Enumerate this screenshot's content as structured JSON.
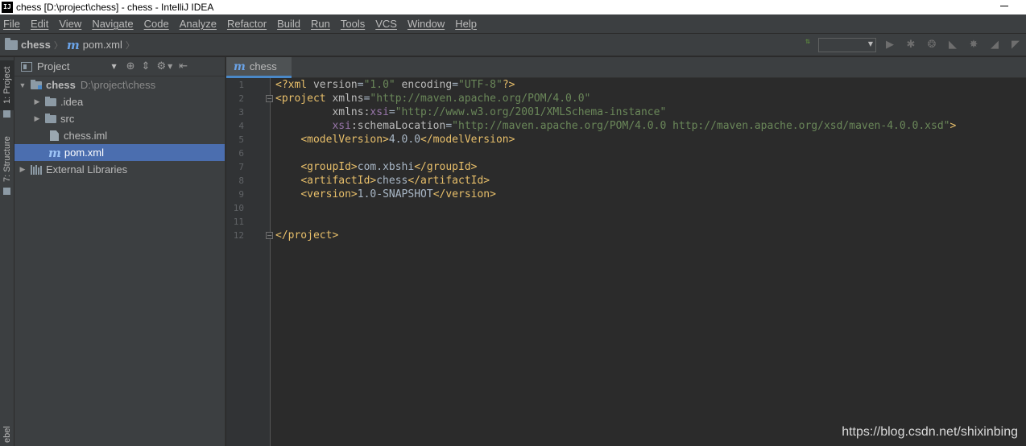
{
  "window": {
    "logo": "IJ",
    "title": "chess [D:\\project\\chess] - chess - IntelliJ IDEA"
  },
  "menu": [
    "File",
    "Edit",
    "View",
    "Navigate",
    "Code",
    "Analyze",
    "Refactor",
    "Build",
    "Run",
    "Tools",
    "VCS",
    "Window",
    "Help"
  ],
  "breadcrumb": {
    "project": "chess",
    "file": "pom.xml",
    "file_icon": "m"
  },
  "left_stripe": {
    "project_tab": "1: Project",
    "structure_tab": "7: Structure",
    "bottom_tab": "ebel"
  },
  "project_panel": {
    "title": "Project",
    "tree": [
      {
        "label": "chess",
        "path": "D:\\project\\chess"
      },
      {
        "label": ".idea"
      },
      {
        "label": "src"
      },
      {
        "label": "chess.iml"
      },
      {
        "label": "pom.xml"
      },
      {
        "label": "External Libraries"
      }
    ]
  },
  "editor": {
    "tab_label": "chess",
    "tab_icon": "m",
    "line_numbers": [
      "1",
      "2",
      "3",
      "4",
      "5",
      "6",
      "7",
      "8",
      "9",
      "10",
      "11",
      "12"
    ],
    "code": {
      "l1": {
        "open": "<?xml ",
        "a1": "version",
        "v1": "\"1.0\"",
        "a2": " encoding",
        "v2": "\"UTF-8\"",
        "close": "?>"
      },
      "l2": {
        "open": "<project ",
        "a1": "xmlns",
        "v1": "\"http://maven.apache.org/POM/4.0.0\""
      },
      "l3": {
        "indent": "         ",
        "a1": "xmlns",
        "colon": ":",
        "ns": "xsi",
        "v1": "\"http://www.w3.org/2001/XMLSchema-instance\""
      },
      "l4": {
        "indent": "         ",
        "ns": "xsi",
        "a1": ":schemaLocation",
        "v1": "\"http://maven.apache.org/POM/4.0.0 http://maven.apache.org/xsd/maven-4.0.0.xsd\"",
        "close": ">"
      },
      "l5": {
        "indent": "    ",
        "open": "<modelVersion>",
        "text": "4.0.0",
        "close": "</modelVersion>"
      },
      "l7": {
        "indent": "    ",
        "open": "<groupId>",
        "text": "com.xbshi",
        "close": "</groupId>"
      },
      "l8": {
        "indent": "    ",
        "open": "<artifactId>",
        "text": "chess",
        "close": "</artifactId>"
      },
      "l9": {
        "indent": "    ",
        "open": "<version>",
        "text": "1.0-SNAPSHOT",
        "close": "</version>"
      },
      "l12": {
        "close": "</project>"
      }
    }
  },
  "watermark": "https://blog.csdn.net/shixinbing",
  "colors": {
    "background": "#2b2b2b",
    "panel": "#3c3f41",
    "selection": "#4b6eaf",
    "xml_tag": "#e8bf6a",
    "xml_value": "#6a8759",
    "xml_namespace": "#9876aa"
  }
}
